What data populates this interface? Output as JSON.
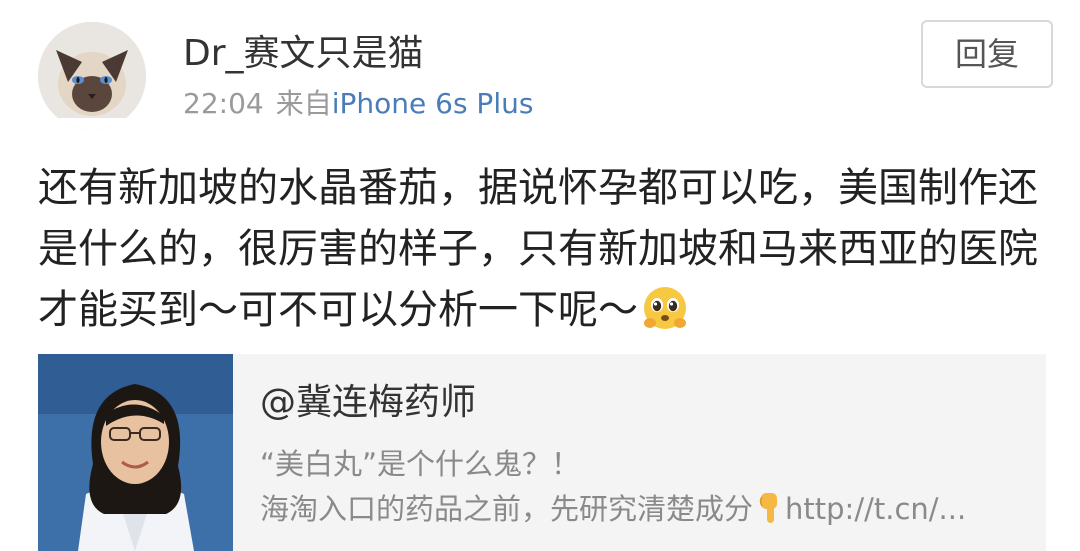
{
  "post": {
    "author": "Dr_赛文只是猫",
    "time": "22:04",
    "via_prefix": "来自",
    "device": "iPhone 6s Plus",
    "reply_label": "回复",
    "text": "还有新加坡的水晶番茄，据说怀孕都可以吃，美国制作还是什么的，很厉害的样子，只有新加坡和马来西亚的医院才能买到～可不可以分析一下呢～",
    "emoji_name": "pleading-face-emoji",
    "avatar_icon": "siamese-cat-avatar"
  },
  "shared_card": {
    "title": "@冀连梅药师",
    "line1": "“美白丸”是个什么鬼？！",
    "line2_text": "海淘入口的药品之前，先研究清楚成分",
    "line2_emoji": "pointing-down-hand-emoji",
    "line2_link": "http://t.cn/...",
    "thumb_icon": "doctor-portrait"
  },
  "colors": {
    "link_blue": "#4a7db8",
    "meta_gray": "#9a9a9a",
    "card_bg": "#f4f4f4",
    "thumb_bg": "#3d6fa8"
  }
}
